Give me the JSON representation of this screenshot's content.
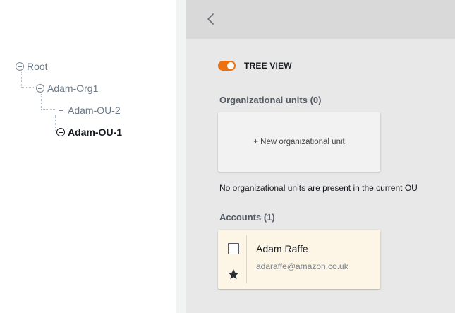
{
  "tree": {
    "root": "Root",
    "org": "Adam-Org1",
    "ou2": "Adam-OU-2",
    "ou1": "Adam-OU-1"
  },
  "panel": {
    "toggle_label": "TREE VIEW",
    "toggle_on": true,
    "org_units_title": "Organizational units (0)",
    "new_ou_label": "+ New organizational unit",
    "empty_message": "No organizational units are present in the current OU",
    "accounts_title": "Accounts (1)",
    "account": {
      "name": "Adam Raffe",
      "email": "adaraffe@amazon.co.uk"
    }
  },
  "colors": {
    "accent": "#ec7211",
    "active_text": "#16191f",
    "account_card_bg": "#fdf6e6"
  }
}
